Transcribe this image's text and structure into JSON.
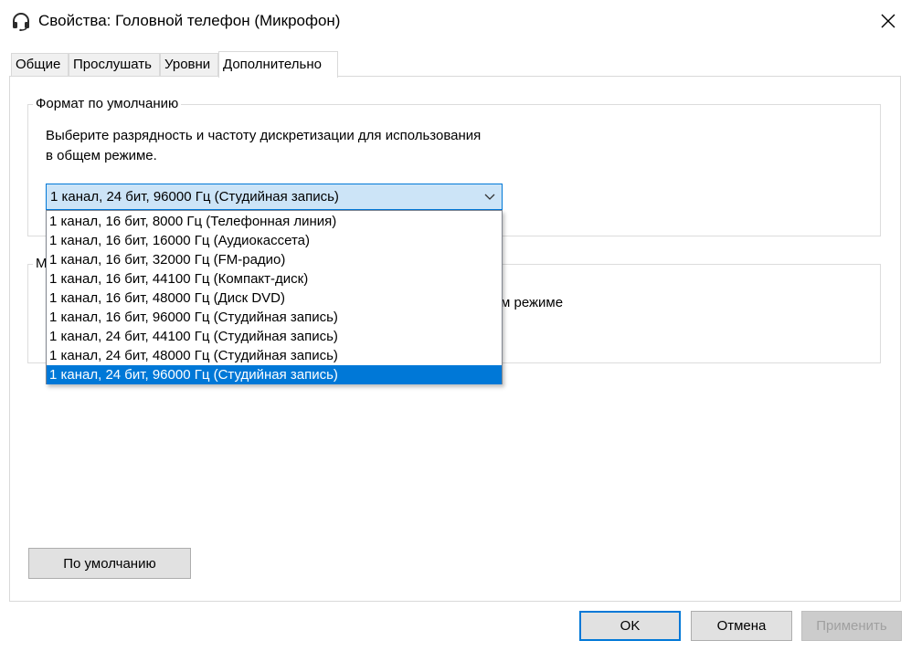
{
  "window": {
    "title": "Свойства: Головной телефон (Микрофон)",
    "close_glyph": "✕"
  },
  "tabs": [
    {
      "label": "Общие"
    },
    {
      "label": "Прослушать"
    },
    {
      "label": "Уровни"
    },
    {
      "label": "Дополнительно",
      "active": true
    }
  ],
  "default_format": {
    "title": "Формат по умолчанию",
    "description_line1": "Выберите разрядность и частоту дискретизации для использования",
    "description_line2": "в общем режиме.",
    "selected": "1 канал, 24 бит, 96000 Гц (Студийная запись)",
    "options": [
      "1 канал, 16 бит, 8000 Гц (Телефонная линия)",
      "1 канал, 16 бит, 16000 Гц (Аудиокассета)",
      "1 канал, 16 бит, 32000 Гц (FM-радио)",
      "1 канал, 16 бит, 44100 Гц (Компакт-диск)",
      "1 канал, 16 бит, 48000 Гц (Диск DVD)",
      "1 канал, 16 бит, 96000 Гц (Студийная запись)",
      "1 канал, 24 бит, 44100 Гц (Студийная запись)",
      "1 канал, 24 бит, 48000 Гц (Студийная запись)",
      "1 канал, 24 бит, 96000 Гц (Студийная запись)"
    ],
    "selected_index": 8
  },
  "monopoly": {
    "title_partial": "М",
    "text_partial": "м режиме"
  },
  "buttons": {
    "restore_defaults": "По умолчанию",
    "ok": "OK",
    "cancel": "Отмена",
    "apply": "Применить"
  },
  "colors": {
    "accent": "#0078d7",
    "combo_bg": "#cce4f7"
  }
}
